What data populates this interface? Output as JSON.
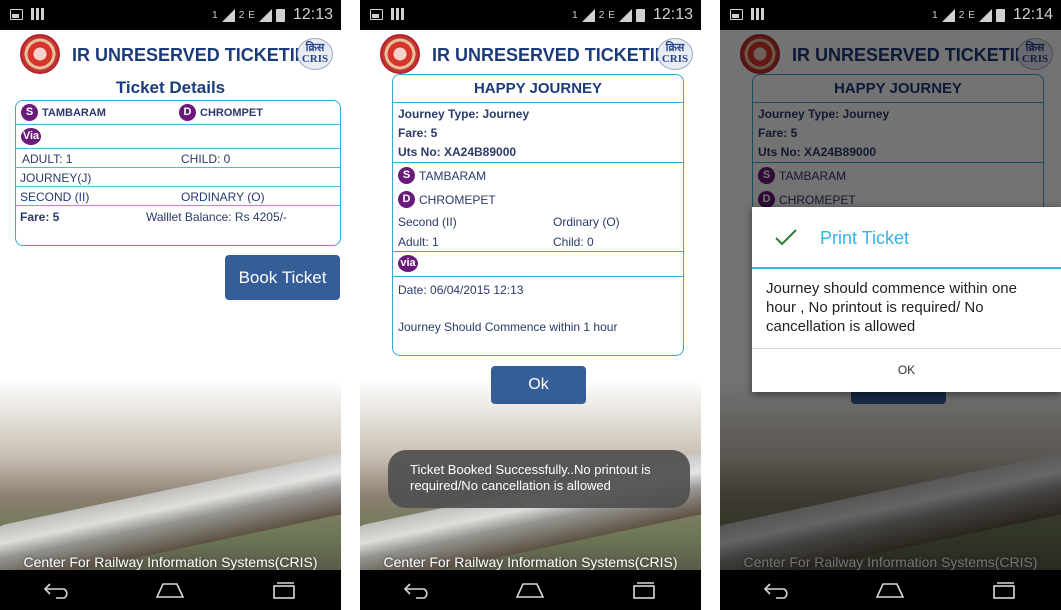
{
  "status": {
    "sim1": "1",
    "sim2": "2",
    "network": "E",
    "time1": "12:13",
    "time2": "12:13",
    "time3": "12:14"
  },
  "app": {
    "title": "IR UNRESERVED TICKETING",
    "cris_logo_top": "क्रिस",
    "cris_logo_bottom": "CRIS",
    "footer": "Center For Railway Information Systems(CRIS)"
  },
  "screen1": {
    "heading": "Ticket Details",
    "source_badge": "S",
    "source": "TAMBARAM",
    "dest_badge": "D",
    "destination": "CHROMPET",
    "via_badge": "Via",
    "adult": "ADULT: 1",
    "child": "CHILD: 0",
    "journey": "JOURNEY(J)",
    "class": "SECOND (II)",
    "train_type": "ORDINARY (O)",
    "fare": "Fare: 5",
    "wallet": "Walllet Balance: Rs 4205/-",
    "book_button": "Book Ticket"
  },
  "screen2": {
    "heading": "HAPPY JOURNEY",
    "journey_type": "Journey Type: Journey",
    "fare": "Fare: 5",
    "uts": "Uts No: XA24B89000",
    "source_badge": "S",
    "source": "TAMBARAM",
    "dest_badge": "D",
    "destination": "CHROMEPET",
    "class": "Second (II)",
    "train_type": "Ordinary (O)",
    "adult": "Adult: 1",
    "child": "Child: 0",
    "via_badge": "via",
    "date": "Date: 06/04/2015 12:13",
    "note": "Journey Should Commence within 1 hour",
    "ok_button": "Ok",
    "toast": "Ticket Booked Successfully..No printout is required/No cancellation is allowed"
  },
  "screen3": {
    "dialog_title": "Print Ticket",
    "dialog_message": "Journey should commence within one hour , No printout is required/ No cancellation is allowed",
    "dialog_ok": "OK"
  },
  "colors": {
    "primary_blue": "#355d98",
    "title_blue": "#1c3b7a",
    "accent": "#33b5e5",
    "badge_purple": "#6a1a7a"
  }
}
